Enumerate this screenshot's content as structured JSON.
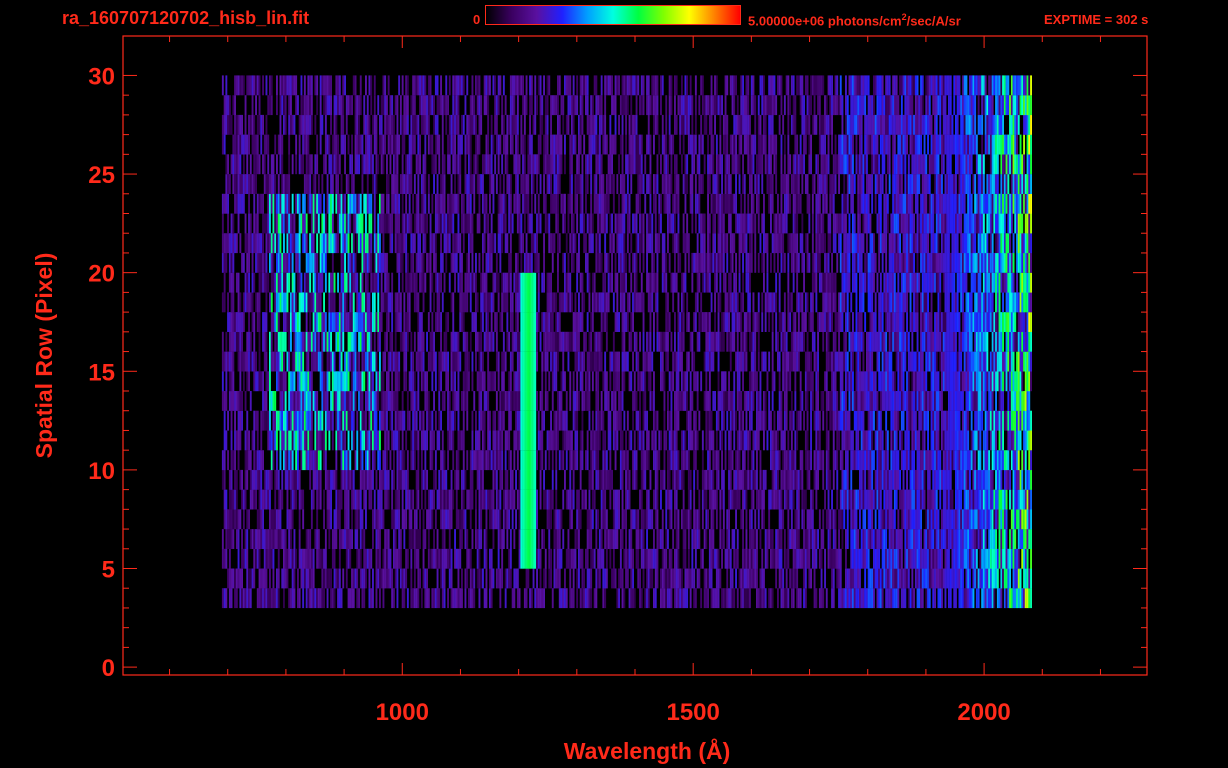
{
  "header": {
    "file_name": "ra_160707120702_hisb_lin.fit",
    "colorbar_min": "0",
    "colorbar_max_prefix": "5.00000e+06 photons/cm",
    "colorbar_max_exp": "2",
    "colorbar_max_suffix": "/sec/A/sr",
    "exptime": "EXPTIME = 302 s"
  },
  "colors": {
    "text": "#ff2a1a",
    "colormap": [
      "#000000",
      "#3a0060",
      "#5a10a0",
      "#2020ff",
      "#00a0ff",
      "#00ffe0",
      "#00ff40",
      "#80ff00",
      "#ffff00",
      "#ff8000",
      "#ff0000"
    ]
  },
  "chart_data": {
    "type": "heatmap",
    "xlabel": "Wavelength (Å)",
    "ylabel": "Spatial Row (Pixel)",
    "xlim": [
      520,
      2280
    ],
    "ylim": [
      -0.4,
      32
    ],
    "x_ticks": [
      1000,
      1500,
      2000
    ],
    "y_ticks": [
      0,
      5,
      10,
      15,
      20,
      25,
      30
    ],
    "colorbar_range": [
      0,
      5000000
    ],
    "colorbar_units": "photons/cm^2/sec/A/sr",
    "exposure_time_s": 302,
    "noise_region": {
      "x_range": [
        690,
        2080
      ],
      "y_range": [
        3,
        30
      ]
    },
    "features": [
      {
        "name": "emission-line-lya",
        "x_center": 1216,
        "y_range": [
          5,
          20
        ],
        "intensity_fraction": 0.6
      },
      {
        "name": "diffuse-arc-feature",
        "x_range": [
          770,
          960
        ],
        "y_range": [
          10,
          24
        ],
        "intensity_fraction": 0.5
      },
      {
        "name": "long-wavelength-edge",
        "x_range": [
          1930,
          2075
        ],
        "y_range": [
          1,
          30
        ],
        "intensity_fraction": 0.55
      }
    ]
  }
}
